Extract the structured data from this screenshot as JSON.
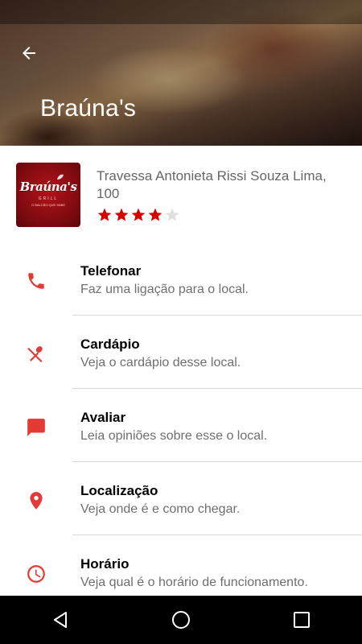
{
  "header": {
    "title": "Braúna's",
    "back_icon": "arrow-back-icon"
  },
  "restaurant": {
    "logo": {
      "script_text": "Braúna's",
      "sub_text": "GRILL",
      "tagline": "O BALCÃO QUE SABE"
    },
    "address": "Travessa Antonieta Rissi Souza Lima, 100",
    "rating": 4,
    "rating_max": 5
  },
  "actions": [
    {
      "id": "telefonar",
      "icon": "phone-icon",
      "label": "Telefonar",
      "desc": "Faz uma ligação para o local."
    },
    {
      "id": "cardapio",
      "icon": "utensils-icon",
      "label": "Cardápio",
      "desc": "Veja o cardápio desse local."
    },
    {
      "id": "avaliar",
      "icon": "chat-bubble-icon",
      "label": "Avaliar",
      "desc": "Leia opiniões sobre esse o local."
    },
    {
      "id": "localizacao",
      "icon": "location-pin-icon",
      "label": "Localização",
      "desc": "Veja onde é e como chegar."
    },
    {
      "id": "horario",
      "icon": "clock-icon",
      "label": "Horário",
      "desc": "Veja qual é o horário de funcionamento."
    }
  ],
  "navbar": {
    "back_icon": "nav-back-icon",
    "home_icon": "nav-home-icon",
    "recents_icon": "nav-recents-icon"
  },
  "colors": {
    "accent": "#e53935",
    "star_filled": "#d50000",
    "star_empty": "#e0e0e0"
  }
}
